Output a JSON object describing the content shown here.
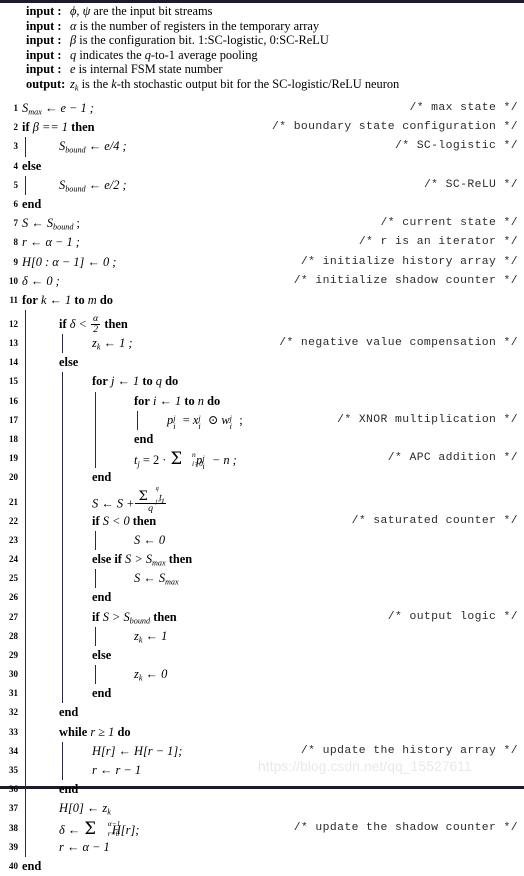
{
  "document": {
    "type": "algorithm-pseudocode",
    "watermark": "https://blog.csdn.net/qq_15527611"
  },
  "header": {
    "rows": [
      {
        "key": "input  :",
        "text": "are the input bit streams"
      },
      {
        "key": "input  :",
        "text": "is the number of registers in the temporary array"
      },
      {
        "key": "input  :",
        "text": "is the configuration bit. 1:SC-logistic, 0:SC-ReLU"
      },
      {
        "key": "input  :",
        "text": "average pooling"
      },
      {
        "key": "input  :",
        "text": "is internal FSM state number"
      },
      {
        "key": "output:",
        "text": "stochastic output bit for the SC-logistic/ReLU neuron"
      }
    ],
    "symbols": {
      "phi_psi": "ϕ, ψ",
      "alpha": "α",
      "beta": "β",
      "q": "q",
      "e": "e",
      "z_k": "z",
      "k_sub": "k",
      "q_to_1_pre": "indicates the",
      "q_to_1_mid": "-to-1",
      "out_is_the": "is the",
      "out_kth": "-th"
    }
  },
  "lines": {
    "n1": "1",
    "n2": "2",
    "n3": "3",
    "n4": "4",
    "n5": "5",
    "n6": "6",
    "n7": "7",
    "n8": "8",
    "n9": "9",
    "n10": "10",
    "n11": "11",
    "n12": "12",
    "n13": "13",
    "n14": "14",
    "n15": "15",
    "n16": "16",
    "n17": "17",
    "n18": "18",
    "n19": "19",
    "n20": "20",
    "n21": "21",
    "n22": "22",
    "n23": "23",
    "n24": "24",
    "n25": "25",
    "n26": "26",
    "n27": "27",
    "n28": "28",
    "n29": "29",
    "n30": "30",
    "n31": "31",
    "n32": "32",
    "n33": "33",
    "n34": "34",
    "n35": "35",
    "n36": "36",
    "n37": "37",
    "n38": "38",
    "n39": "39",
    "n40": "40"
  },
  "comments": {
    "c1": "/* max state */",
    "c2": "/* boundary state configuration */",
    "c3": "/* SC-logistic */",
    "c5": "/* SC-ReLU */",
    "c7": "/* current state */",
    "c8": "/* r is an iterator */",
    "c9": "/* initialize history array */",
    "c10": "/* initialize shadow counter */",
    "c13": "/* negative value compensation */",
    "c17": "/* XNOR multiplication */",
    "c19": "/* APC addition */",
    "c22": "/* saturated counter */",
    "c27": "/* output logic */",
    "c34": "/* update the history array */",
    "c38": "/* update the shadow counter */"
  },
  "keywords": {
    "if": "if",
    "then": "then",
    "else": "else",
    "elseif": "else if",
    "end": "end",
    "for": "for",
    "to": "to",
    "do": "do",
    "while": "while"
  },
  "code": {
    "l1": {
      "lhs": "S",
      "lhs_sub": "max",
      "arrow": "←",
      "rhs": "e − 1 ;"
    },
    "l2": {
      "cond": "β == 1"
    },
    "l3": {
      "lhs": "S",
      "lhs_sub": "bound",
      "arrow": "←",
      "rhs": "e/4 ;"
    },
    "l5": {
      "lhs": "S",
      "lhs_sub": "bound",
      "arrow": "←",
      "rhs": "e/2 ;"
    },
    "l7": {
      "lhs": "S",
      "arrow": "←",
      "rhs": "S",
      "rhs_sub": "bound",
      "tail": " ;"
    },
    "l8": {
      "lhs": "r",
      "arrow": "←",
      "rhs": "α − 1 ;"
    },
    "l9": {
      "lhs": "H[0 : α − 1]",
      "arrow": "←",
      "rhs": "0 ;"
    },
    "l10": {
      "lhs": "δ",
      "arrow": "←",
      "rhs": "0 ;"
    },
    "l11": {
      "var": "k",
      "from": "1",
      "to": "m"
    },
    "l12": {
      "cond_lhs": "δ <",
      "num": "α",
      "den": "2"
    },
    "l13": {
      "lhs": "z",
      "lhs_sub": "k",
      "arrow": "←",
      "rhs": "1 ;"
    },
    "l15": {
      "var": "j",
      "from": "1",
      "to": "q"
    },
    "l16": {
      "var": "i",
      "from": "1",
      "to": "n"
    },
    "l17": {
      "p": "p",
      "p_sub": "i",
      "p_sup": "j",
      "eq": "=",
      "x": "x",
      "x_sub": "i",
      "x_sup": "j",
      "xnor": "⊙",
      "w": "w",
      "w_sub": "i",
      "w_sup": "j",
      "tail": " ;"
    },
    "l19": {
      "t": "t",
      "t_sub": "j",
      "eq": "=",
      "coef": "2 ·",
      "sum_top": "n",
      "sum_bot": "i=0",
      "p": "p",
      "p_sub": "i",
      "p_sup": "j",
      "tail": "− n ;"
    },
    "l21": {
      "lhs": "S",
      "arrow": "←",
      "rhs": "S +",
      "sum_top": "q",
      "sum_bot": "j=1",
      "num_t": "t",
      "num_t_sub": "j",
      "den": "q"
    },
    "l22": {
      "cond": "S < 0"
    },
    "l23": {
      "lhs": "S",
      "arrow": "←",
      "rhs": "0"
    },
    "l24": {
      "cond_lhs": "S >",
      "cond_rhs": "S",
      "cond_rhs_sub": "max"
    },
    "l25": {
      "lhs": "S",
      "arrow": "←",
      "rhs": "S",
      "rhs_sub": "max"
    },
    "l27": {
      "cond_lhs": "S >",
      "cond_rhs": "S",
      "cond_rhs_sub": "bound"
    },
    "l28": {
      "lhs": "z",
      "lhs_sub": "k",
      "arrow": "←",
      "rhs": "1"
    },
    "l30": {
      "lhs": "z",
      "lhs_sub": "k",
      "arrow": "←",
      "rhs": "0"
    },
    "l33": {
      "cond": "r ≥ 1"
    },
    "l34": {
      "lhs": "H[r]",
      "arrow": "←",
      "rhs": "H[r − 1];"
    },
    "l35": {
      "lhs": "r",
      "arrow": "←",
      "rhs": "r − 1"
    },
    "l37": {
      "lhs": "H[0]",
      "arrow": "←",
      "rhs": "z",
      "rhs_sub": "k"
    },
    "l38": {
      "lhs": "δ",
      "arrow": "←",
      "sum_top": "α−1",
      "sum_bot": "r=0",
      "rhs": "H[r];"
    },
    "l39": {
      "lhs": "r",
      "arrow": "←",
      "rhs": "α − 1"
    }
  }
}
